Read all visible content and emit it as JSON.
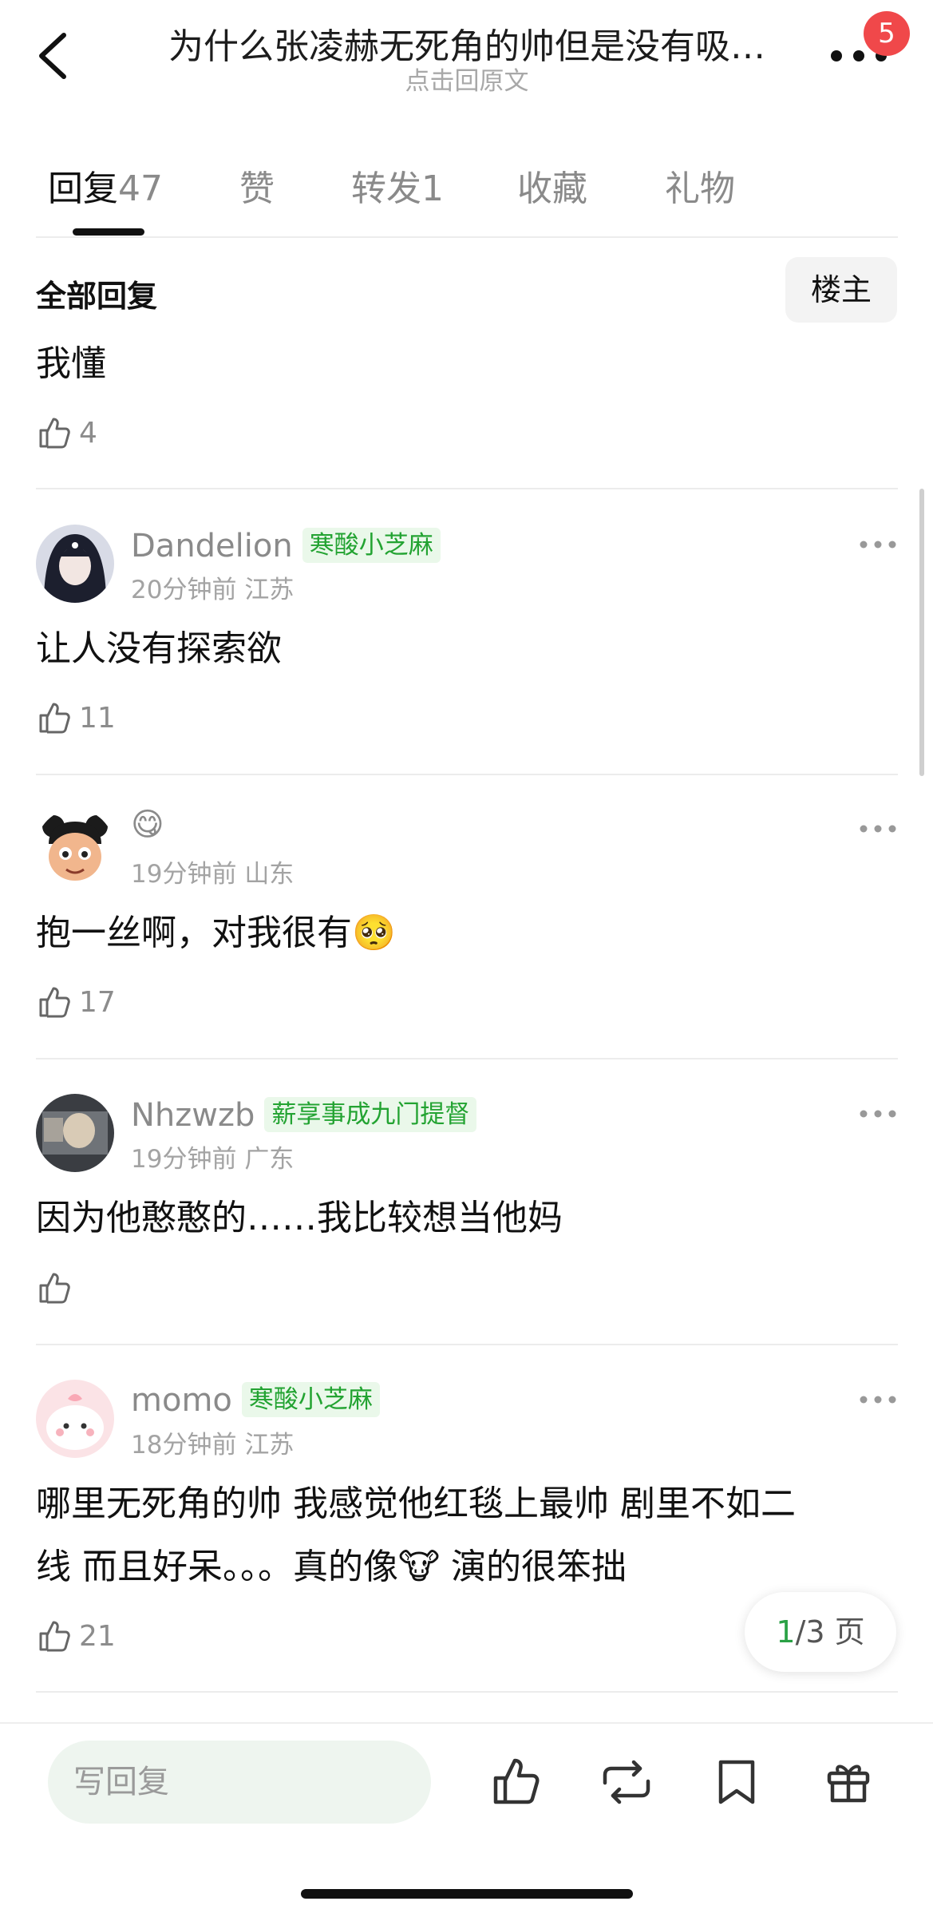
{
  "header": {
    "title": "为什么张凌赫无死角的帅但是没有吸…",
    "subtitle": "点击回原文",
    "notification_count": "5"
  },
  "tabs": [
    {
      "label": "回复",
      "count": "47",
      "active": true
    },
    {
      "label": "赞",
      "count": ""
    },
    {
      "label": "转发",
      "count": "1"
    },
    {
      "label": "收藏",
      "count": ""
    },
    {
      "label": "礼物",
      "count": ""
    }
  ],
  "filter": {
    "all_replies": "全部回复",
    "owner_button": "楼主"
  },
  "first_comment": {
    "text": "我懂",
    "likes": "4"
  },
  "comments": [
    {
      "username": "Dandelion",
      "tag": "寒酸小芝麻",
      "time": "20分钟前",
      "location": "江苏",
      "text": "让人没有探索欲",
      "likes": "11"
    },
    {
      "username": "😋",
      "tag": "",
      "time": "19分钟前",
      "location": "山东",
      "text": "抱一丝啊，对我很有🥺",
      "likes": "17"
    },
    {
      "username": "Nhzwzb",
      "tag": "薪享事成九门提督",
      "time": "19分钟前",
      "location": "广东",
      "text": "因为他憨憨的……我比较想当他妈",
      "likes": ""
    },
    {
      "username": "momo",
      "tag": "寒酸小芝麻",
      "time": "18分钟前",
      "location": "江苏",
      "text_line1": "哪里无死角的帅 我感觉他红毯上最帅 剧里不如二",
      "text_line2": "线 而且好呆。。。真的像🐮 演的很笨拙",
      "likes": "21"
    }
  ],
  "pagination": {
    "current": "1",
    "total": "/3 页"
  },
  "bottom_bar": {
    "reply_placeholder": "写回复"
  },
  "colors": {
    "accent_green": "#23a332",
    "tag_bg": "#eaf8ea",
    "badge_red": "#f0484a"
  }
}
